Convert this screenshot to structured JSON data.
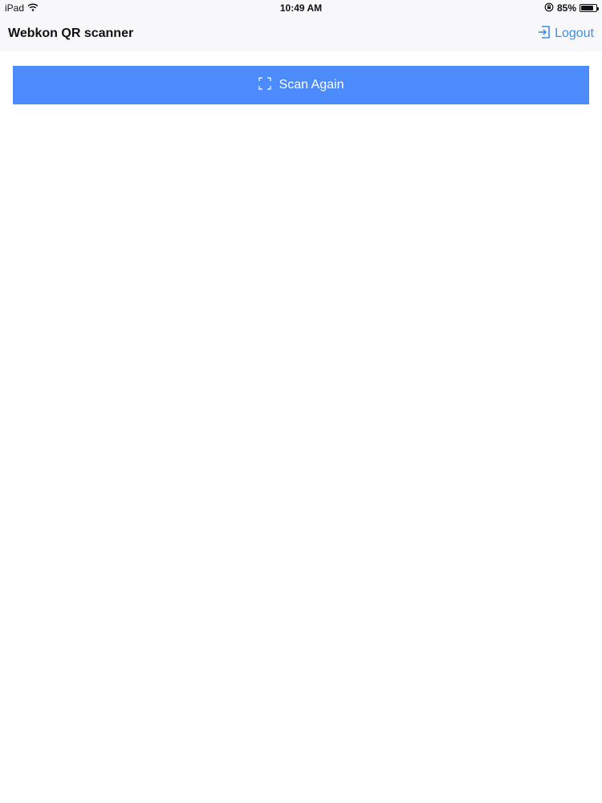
{
  "status_bar": {
    "device": "iPad",
    "time": "10:49 AM",
    "battery_text": "85%",
    "battery_level": 0.85,
    "icons": [
      "wifi-icon",
      "orientation-lock-icon",
      "battery-icon"
    ]
  },
  "nav": {
    "title": "Webkon QR scanner",
    "logout_label": "Logout",
    "logout_icon": "logout-icon",
    "accent_color": "#3f8ee8"
  },
  "main": {
    "scan_button_label": "Scan Again",
    "scan_button_icon": "scan-frame-icon",
    "scan_button_color": "#4b8bfb"
  }
}
